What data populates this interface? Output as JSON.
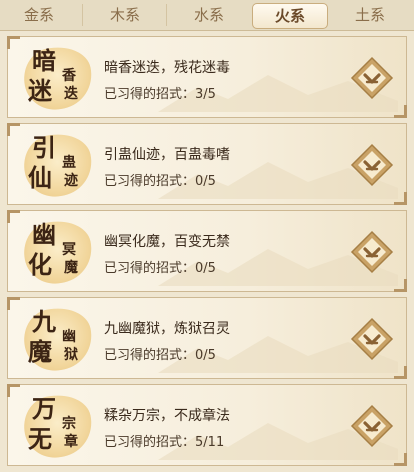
{
  "tabs": [
    {
      "label": "金系",
      "active": false
    },
    {
      "label": "木系",
      "active": false
    },
    {
      "label": "水系",
      "active": false
    },
    {
      "label": "火系",
      "active": true
    },
    {
      "label": "土系",
      "active": false
    }
  ],
  "prefix": "已习得的招式：",
  "cards": [
    {
      "badge": [
        "暗",
        "迷",
        "香",
        "迭"
      ],
      "title": "暗香迷迭，残花迷毒",
      "progress": "3/5"
    },
    {
      "badge": [
        "引",
        "仙",
        "蛊",
        "迹"
      ],
      "title": "引蛊仙迹，百蛊毒嗜",
      "progress": "0/5"
    },
    {
      "badge": [
        "幽",
        "化",
        "冥",
        "魔"
      ],
      "title": "幽冥化魔，百变无禁",
      "progress": "0/5"
    },
    {
      "badge": [
        "九",
        "魔",
        "幽",
        "狱"
      ],
      "title": "九幽魔狱，炼狱召灵",
      "progress": "0/5"
    },
    {
      "badge": [
        "万",
        "无",
        "宗",
        "章"
      ],
      "title": "糅杂万宗，不成章法",
      "progress": "5/11"
    }
  ],
  "colors": {
    "accent": "#c49a5a",
    "text": "#3a2a1c",
    "card_bg": "#f7efde"
  },
  "icons": {
    "expand": "chevron-down-icon"
  }
}
